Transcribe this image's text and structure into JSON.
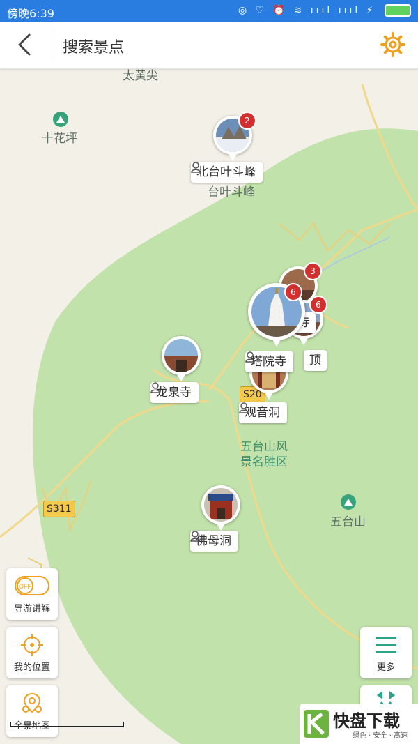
{
  "status": {
    "time": "傍晚6:39",
    "icons": "◎ ♡ ⏰ ≋ ıııl ıııl ⚡"
  },
  "header": {
    "title": "搜索景点"
  },
  "map": {
    "labels": {
      "taihuangjian": "太黄尖",
      "shihuaping": "十花坪",
      "beitaiyedoufeng_road": "台叶斗峰",
      "scenic_area_line1": "五台山风",
      "scenic_area_line2": "景名胜区",
      "wutaishan": "五台山"
    },
    "roads": {
      "s311": "S311",
      "s20x": "S20"
    }
  },
  "pois": [
    {
      "name": "北台叶斗峰",
      "count": "2"
    },
    {
      "name": "龙泉寺"
    },
    {
      "name": "塔院寺",
      "stack_counts": [
        "3",
        "6",
        "6"
      ]
    },
    {
      "name": "观音洞"
    },
    {
      "name": "佛母洞"
    }
  ],
  "hidden_labels": {
    "partial1": "寺",
    "partial2": "顶"
  },
  "controls": {
    "toggle_state": "OFF",
    "guide_label": "导游讲解",
    "location_label": "我的位置",
    "panorama_label": "全景地图",
    "more_label": "更多"
  },
  "watermark": {
    "main": "快盘下载",
    "sub": "绿色 · 安全 · 高速"
  },
  "colors": {
    "statusbar": "#2a7de0",
    "gear": "#f0a020",
    "green_area": "#bfe0a8",
    "badge": "#d32f2f"
  }
}
